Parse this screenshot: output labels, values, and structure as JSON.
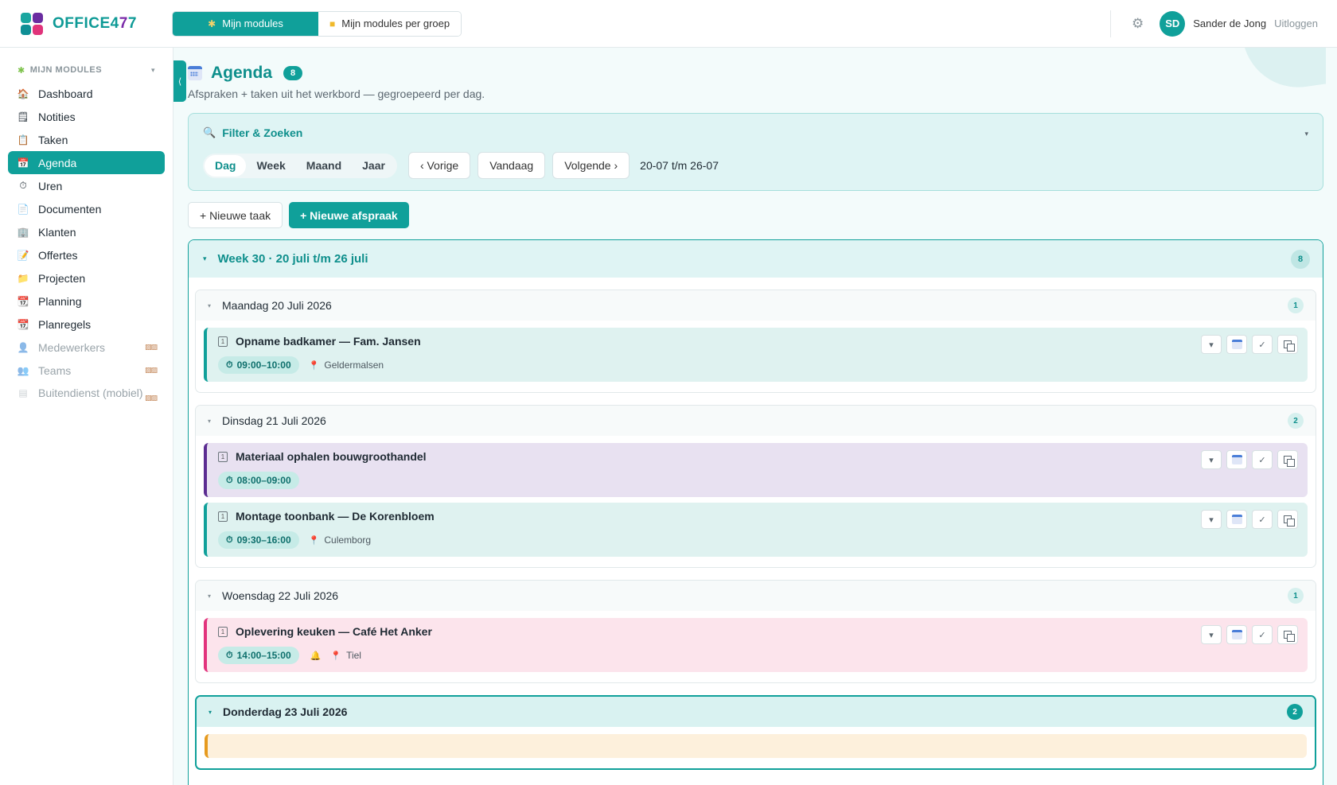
{
  "app": {
    "logo_prefix": "OFFICE4",
    "logo_highlight": "7",
    "logo_suffix": "7"
  },
  "top_tabs": [
    {
      "label": "Mijn modules",
      "icon": "puzzle-icon",
      "active": true
    },
    {
      "label": "Mijn modules per groep",
      "icon": "folder-icon",
      "active": false
    }
  ],
  "user": {
    "initials": "SD",
    "name": "Sander de Jong",
    "logout_label": "Uitloggen"
  },
  "sidebar": {
    "section_label": "MIJN MODULES",
    "items": [
      {
        "label": "Dashboard",
        "icon": "house-icon",
        "glyph": "🏠"
      },
      {
        "label": "Notities",
        "icon": "notes-icon",
        "glyph": "🗒"
      },
      {
        "label": "Taken",
        "icon": "tasks-icon",
        "glyph": "📋"
      },
      {
        "label": "Agenda",
        "icon": "calendar-icon",
        "glyph": "📅",
        "active": true
      },
      {
        "label": "Uren",
        "icon": "clock-icon",
        "glyph": "⏱"
      },
      {
        "label": "Documenten",
        "icon": "document-icon",
        "glyph": "📄"
      },
      {
        "label": "Klanten",
        "icon": "building-icon",
        "glyph": "🏢"
      },
      {
        "label": "Offertes",
        "icon": "quote-icon",
        "glyph": "📝"
      },
      {
        "label": "Projecten",
        "icon": "folder-icon",
        "glyph": "📁"
      },
      {
        "label": "Planning",
        "icon": "planning-icon",
        "glyph": "📆"
      },
      {
        "label": "Planregels",
        "icon": "plan-rules-icon",
        "glyph": "📆"
      },
      {
        "label": "Medewerkers",
        "icon": "person-icon",
        "glyph": "👤",
        "disabled": true
      },
      {
        "label": "Teams",
        "icon": "people-icon",
        "glyph": "👥",
        "disabled": true
      },
      {
        "label": "Buitendienst (mobiel)",
        "icon": "mobile-icon",
        "glyph": "▤",
        "disabled": true
      }
    ]
  },
  "page": {
    "title": "Agenda",
    "count": "8",
    "subtitle": "Afspraken + taken uit het werkbord — gegroepeerd per dag."
  },
  "filter": {
    "title": "Filter & Zoeken",
    "views": [
      "Dag",
      "Week",
      "Maand",
      "Jaar"
    ],
    "active_view": "Dag",
    "prev_label": "‹ Vorige",
    "today_label": "Vandaag",
    "next_label": "Volgende ›",
    "range": "20-07 t/m 26-07"
  },
  "actions": {
    "new_task": "+ Nieuwe taak",
    "new_appointment": "+ Nieuwe afspraak"
  },
  "week": {
    "title": "Week 30 · 20 juli t/m 26 juli",
    "count": "8",
    "days": [
      {
        "title": "Maandag 20 Juli 2026",
        "count": "1",
        "items": [
          {
            "title": "Opname badkamer — Fam. Jansen",
            "time": "09:00–10:00",
            "location": "Geldermalsen",
            "color": "teal"
          }
        ]
      },
      {
        "title": "Dinsdag 21 Juli 2026",
        "count": "2",
        "items": [
          {
            "title": "Materiaal ophalen bouwgroothandel",
            "time": "08:00–09:00",
            "color": "purple"
          },
          {
            "title": "Montage toonbank — De Korenbloem",
            "time": "09:30–16:00",
            "location": "Culemborg",
            "color": "teal"
          }
        ]
      },
      {
        "title": "Woensdag 22 Juli 2026",
        "count": "1",
        "items": [
          {
            "title": "Oplevering keuken — Café Het Anker",
            "time": "14:00–15:00",
            "location": "Tiel",
            "reminder": true,
            "color": "pink"
          }
        ]
      },
      {
        "title": "Donderdag 23 Juli 2026",
        "count": "2",
        "today": true,
        "items": []
      }
    ]
  }
}
